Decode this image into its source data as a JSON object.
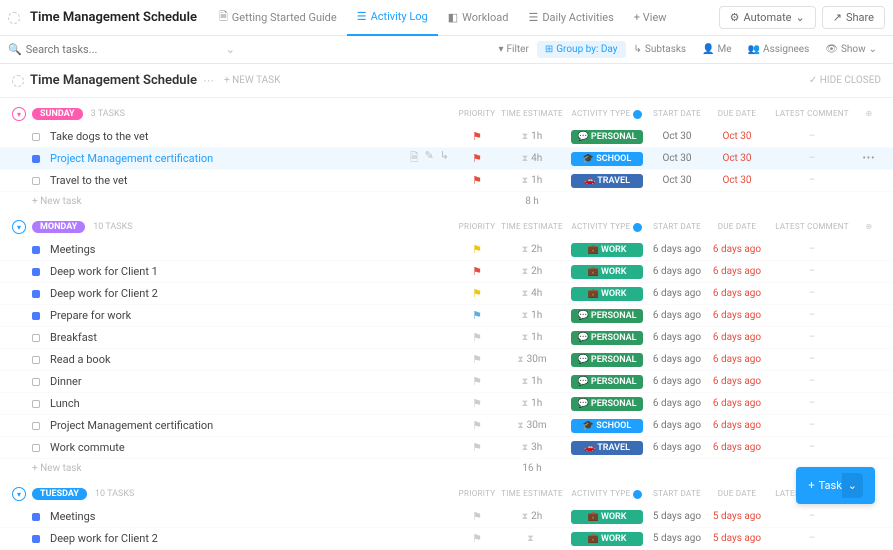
{
  "header": {
    "title": "Time Management Schedule",
    "tabs": [
      {
        "label": "Getting Started Guide"
      },
      {
        "label": "Activity Log"
      },
      {
        "label": "Workload"
      },
      {
        "label": "Daily Activities"
      }
    ],
    "add_view": "+ View",
    "automate": "Automate",
    "share": "Share"
  },
  "search": {
    "placeholder": "Search tasks...",
    "filter": "Filter",
    "group_by": "Group by: Day",
    "subtasks": "Subtasks",
    "me": "Me",
    "assignees": "Assignees",
    "show": "Show"
  },
  "list": {
    "title": "Time Management Schedule",
    "new_task": "+ NEW TASK",
    "hide_closed": "✓ HIDE CLOSED"
  },
  "cols": {
    "priority": "PRIORITY",
    "time": "TIME ESTIMATE",
    "type": "ACTIVITY TYPE",
    "start": "START DATE",
    "due": "DUE DATE",
    "comment": "LATEST COMMENT"
  },
  "groups": [
    {
      "id": "sunday",
      "label": "SUNDAY",
      "count": "3 TASKS",
      "total": "8 h",
      "tasks": [
        {
          "name": "Take dogs to the vet",
          "status": "open",
          "flag": "red",
          "time": "1h",
          "type": "PERSONAL",
          "type_cls": "personal",
          "start": "Oct 30",
          "due": "Oct 30",
          "due_red": true
        },
        {
          "name": "Project Management certification",
          "status": "blue",
          "sel": true,
          "link": true,
          "flag": "red",
          "time": "4h",
          "type": "SCHOOL",
          "type_cls": "school",
          "start": "Oct 30",
          "due": "Oct 30",
          "due_red": true,
          "actions": true,
          "more": true
        },
        {
          "name": "Travel to the vet",
          "status": "open",
          "flag": "red",
          "time": "1h",
          "type": "TRAVEL",
          "type_cls": "travel",
          "start": "Oct 30",
          "due": "Oct 30",
          "due_red": true
        }
      ]
    },
    {
      "id": "monday",
      "label": "MONDAY",
      "count": "10 TASKS",
      "total": "16 h",
      "tasks": [
        {
          "name": "Meetings",
          "status": "blue",
          "flag": "yellow",
          "time": "2h",
          "type": "WORK",
          "type_cls": "work",
          "start": "6 days ago",
          "due": "6 days ago",
          "due_red": true
        },
        {
          "name": "Deep work for Client 1",
          "status": "blue",
          "flag": "red",
          "time": "2h",
          "type": "WORK",
          "type_cls": "work",
          "start": "6 days ago",
          "due": "6 days ago",
          "due_red": true
        },
        {
          "name": "Deep work for Client 2",
          "status": "blue",
          "flag": "yellow",
          "time": "4h",
          "type": "WORK",
          "type_cls": "work",
          "start": "6 days ago",
          "due": "6 days ago",
          "due_red": true
        },
        {
          "name": "Prepare for work",
          "status": "blue",
          "flag": "cyan",
          "time": "1h",
          "type": "PERSONAL",
          "type_cls": "personal",
          "start": "6 days ago",
          "due": "6 days ago",
          "due_red": true
        },
        {
          "name": "Breakfast",
          "status": "open",
          "flag": "grey",
          "time": "1h",
          "type": "PERSONAL",
          "type_cls": "personal",
          "start": "6 days ago",
          "due": "6 days ago",
          "due_red": true
        },
        {
          "name": "Read a book",
          "status": "open",
          "flag": "grey",
          "time": "30m",
          "type": "PERSONAL",
          "type_cls": "personal",
          "start": "6 days ago",
          "due": "6 days ago",
          "due_red": true
        },
        {
          "name": "Dinner",
          "status": "open",
          "flag": "grey",
          "time": "1h",
          "type": "PERSONAL",
          "type_cls": "personal",
          "start": "6 days ago",
          "due": "6 days ago",
          "due_red": true
        },
        {
          "name": "Lunch",
          "status": "open",
          "flag": "grey",
          "time": "1h",
          "type": "PERSONAL",
          "type_cls": "personal",
          "start": "6 days ago",
          "due": "6 days ago",
          "due_red": true
        },
        {
          "name": "Project Management certification",
          "status": "open",
          "flag": "grey",
          "time": "30m",
          "type": "SCHOOL",
          "type_cls": "school",
          "start": "6 days ago",
          "due": "6 days ago",
          "due_red": true
        },
        {
          "name": "Work commute",
          "status": "open",
          "flag": "grey",
          "time": "3h",
          "type": "TRAVEL",
          "type_cls": "travel",
          "start": "6 days ago",
          "due": "6 days ago",
          "due_red": true
        }
      ]
    },
    {
      "id": "tuesday",
      "label": "TUESDAY",
      "count": "10 TASKS",
      "total": "",
      "tasks": [
        {
          "name": "Meetings",
          "status": "blue",
          "flag": "grey",
          "time": "2h",
          "type": "WORK",
          "type_cls": "work",
          "start": "5 days ago",
          "due": "5 days ago",
          "due_red": true
        },
        {
          "name": "Deep work for Client 2",
          "status": "blue",
          "flag": "grey",
          "time": "",
          "type": "WORK",
          "type_cls": "work",
          "start": "5 days ago",
          "due": "5 days ago",
          "due_red": true
        }
      ]
    }
  ],
  "new_task_row": "+ New task",
  "fab": "Task",
  "icons": {
    "personal": "💬",
    "school": "🎓",
    "travel": "🚗",
    "work": "💼"
  }
}
